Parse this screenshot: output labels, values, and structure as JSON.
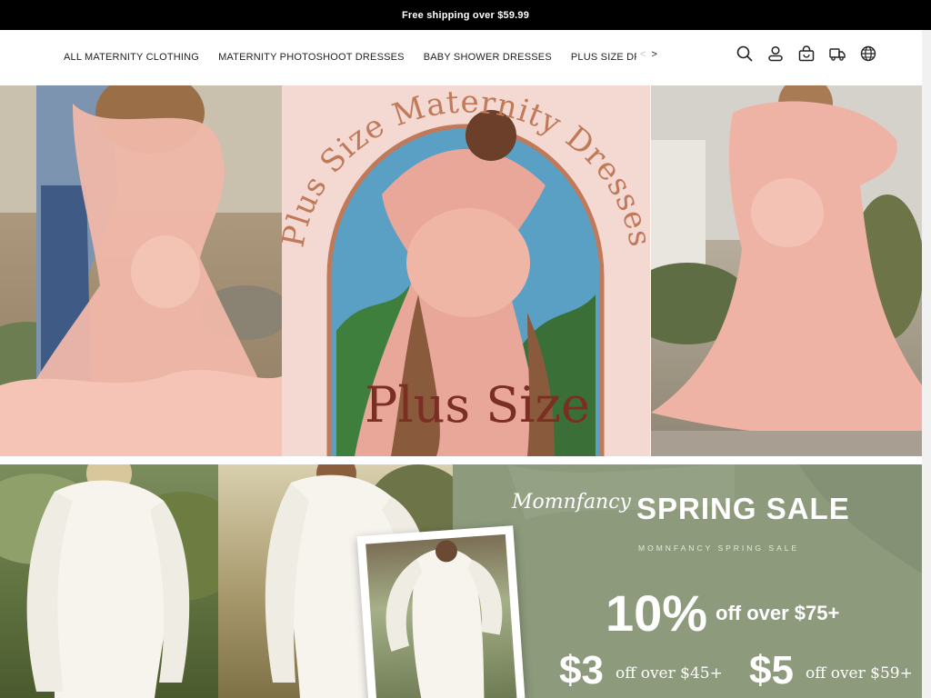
{
  "announcement": {
    "text": "Free shipping over $59.99"
  },
  "nav": {
    "items": [
      {
        "label": "ALL MATERNITY CLOTHING"
      },
      {
        "label": "MATERNITY PHOTOSHOOT DRESSES"
      },
      {
        "label": "BABY SHOWER DRESSES"
      },
      {
        "label": "PLUS SIZE DRESSES"
      }
    ],
    "prev_arrow": "<",
    "next_arrow": ">"
  },
  "header_icons": [
    "search-icon",
    "account-icon",
    "cart-icon",
    "shipping-truck-icon",
    "globe-icon"
  ],
  "banner_plus_size": {
    "arc_text": "Plus Size Maternity Dresses",
    "tag": "Plus Size"
  },
  "banner_spring": {
    "brand": "Momnfancy",
    "title": "SPRING SALE",
    "subtitle": "MOMNFANCY SPRING SALE",
    "offer_main_value": "10%",
    "offer_main_note": "off over $75+",
    "offer_a_value": "$3",
    "offer_a_note": "off over $45+",
    "offer_b_value": "$5",
    "offer_b_note": "off over $59+"
  },
  "colors": {
    "announce_bg": "#000000",
    "pink_panel": "#f4d9d2",
    "arc_border": "#c07a5a",
    "plus_size_text": "#7a2f22",
    "sage_bg": "#8d9a7c",
    "dress_pink": "#f2b8aa",
    "dress_white": "#f7f4ee"
  }
}
